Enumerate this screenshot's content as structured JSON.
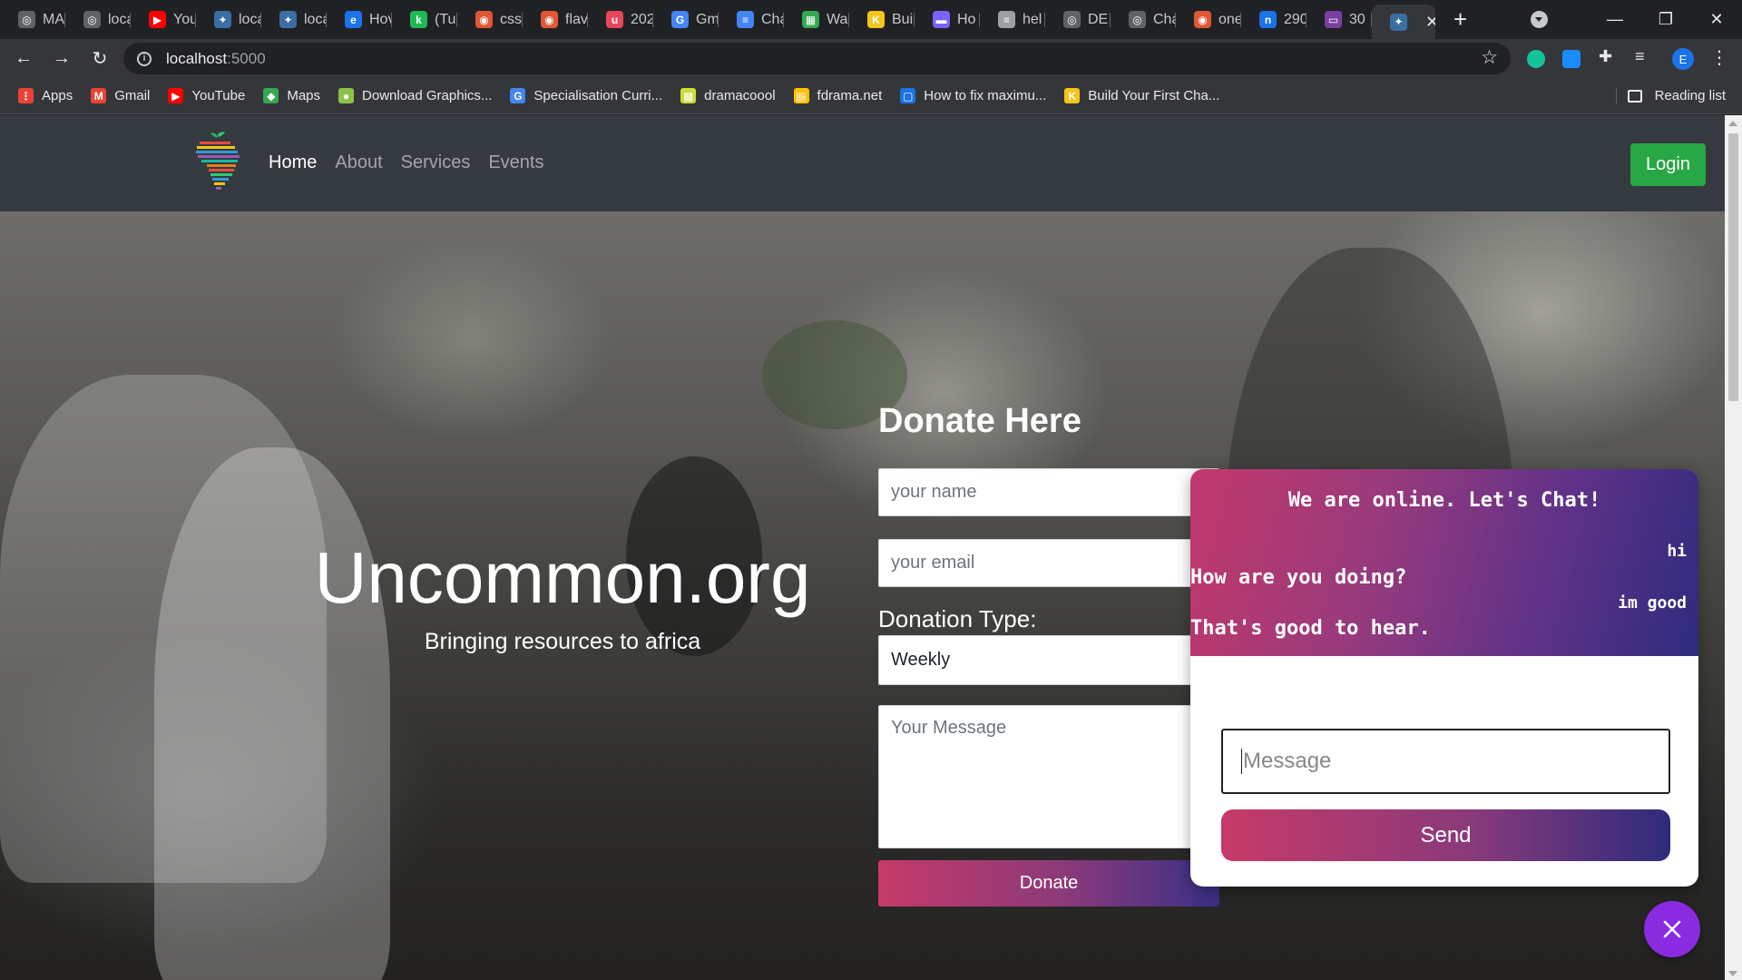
{
  "browser": {
    "tabs": [
      {
        "label": "MA",
        "color": "#5f6368",
        "glyph": "◎"
      },
      {
        "label": "loca",
        "color": "#5f6368",
        "glyph": "◎"
      },
      {
        "label": "You",
        "color": "#ff0000",
        "glyph": "▶"
      },
      {
        "label": "loca",
        "color": "#3a6ea5",
        "glyph": "✦"
      },
      {
        "label": "loca",
        "color": "#3a6ea5",
        "glyph": "✦"
      },
      {
        "label": "Hov",
        "color": "#1a73e8",
        "glyph": "e"
      },
      {
        "label": "(Tu",
        "color": "#1db954",
        "glyph": "k"
      },
      {
        "label": "css",
        "color": "#de5833",
        "glyph": "◉"
      },
      {
        "label": "flav",
        "color": "#de5833",
        "glyph": "◉"
      },
      {
        "label": "202",
        "color": "#e8455b",
        "glyph": "u"
      },
      {
        "label": "Gm",
        "color": "#4285f4",
        "glyph": "G"
      },
      {
        "label": "Cha",
        "color": "#4285f4",
        "glyph": "≡"
      },
      {
        "label": "Wa",
        "color": "#34a853",
        "glyph": "▦"
      },
      {
        "label": "Bui",
        "color": "#f5c518",
        "glyph": "K"
      },
      {
        "label": "Ho",
        "color": "#7b61ff",
        "glyph": "▬"
      },
      {
        "label": "hel",
        "color": "#9aa0a6",
        "glyph": "≡"
      },
      {
        "label": "DE",
        "color": "#5f6368",
        "glyph": "◎"
      },
      {
        "label": "Cha",
        "color": "#5f6368",
        "glyph": "◎"
      },
      {
        "label": "one",
        "color": "#de5833",
        "glyph": "◉"
      },
      {
        "label": "290",
        "color": "#1a73e8",
        "glyph": "n"
      },
      {
        "label": "30",
        "color": "#7b3fa0",
        "glyph": "▭"
      }
    ],
    "active_tab_close": "✕",
    "new_tab": "+",
    "window_controls": {
      "minimize": "—",
      "maximize": "❐",
      "close": "✕"
    },
    "url_host": "localhost",
    "url_port": ":5000",
    "profile_initial": "E",
    "bookmarks": [
      {
        "label": "Apps",
        "color": "#ea4335",
        "glyph": "⋮"
      },
      {
        "label": "Gmail",
        "color": "#ea4335",
        "glyph": "M"
      },
      {
        "label": "YouTube",
        "color": "#ff0000",
        "glyph": "▶"
      },
      {
        "label": "Maps",
        "color": "#34a853",
        "glyph": "◆"
      },
      {
        "label": "Download Graphics...",
        "color": "#8bc34a",
        "glyph": "●"
      },
      {
        "label": "Specialisation Curri...",
        "color": "#4285f4",
        "glyph": "G"
      },
      {
        "label": "dramacoool",
        "color": "#cddc39",
        "glyph": "▦"
      },
      {
        "label": "fdrama.net",
        "color": "#ffc107",
        "glyph": "▤"
      },
      {
        "label": "How to fix maximu...",
        "color": "#1a73e8",
        "glyph": "▢"
      },
      {
        "label": "Build Your First Cha...",
        "color": "#f5c518",
        "glyph": "K"
      }
    ],
    "reading_list": "Reading list"
  },
  "site": {
    "nav": [
      "Home",
      "About",
      "Services",
      "Events"
    ],
    "login_label": "Login",
    "hero_title": "Uncommon.org",
    "hero_subtitle": "Bringing resources to africa",
    "donate": {
      "heading": "Donate Here",
      "name_placeholder": "your name",
      "email_placeholder": "your email",
      "type_label": "Donation Type:",
      "type_value": "Weekly",
      "message_placeholder": "Your Message",
      "button_label": "Donate"
    }
  },
  "chat": {
    "title": "We are online. Let's Chat!",
    "messages": [
      {
        "from": "user",
        "text": "hi"
      },
      {
        "from": "bot",
        "text": "How are you doing?"
      },
      {
        "from": "user",
        "text": "im good"
      },
      {
        "from": "bot",
        "text": "That's good to hear."
      }
    ],
    "input_placeholder": "Message",
    "send_label": "Send",
    "toggle_icon": "✕"
  }
}
